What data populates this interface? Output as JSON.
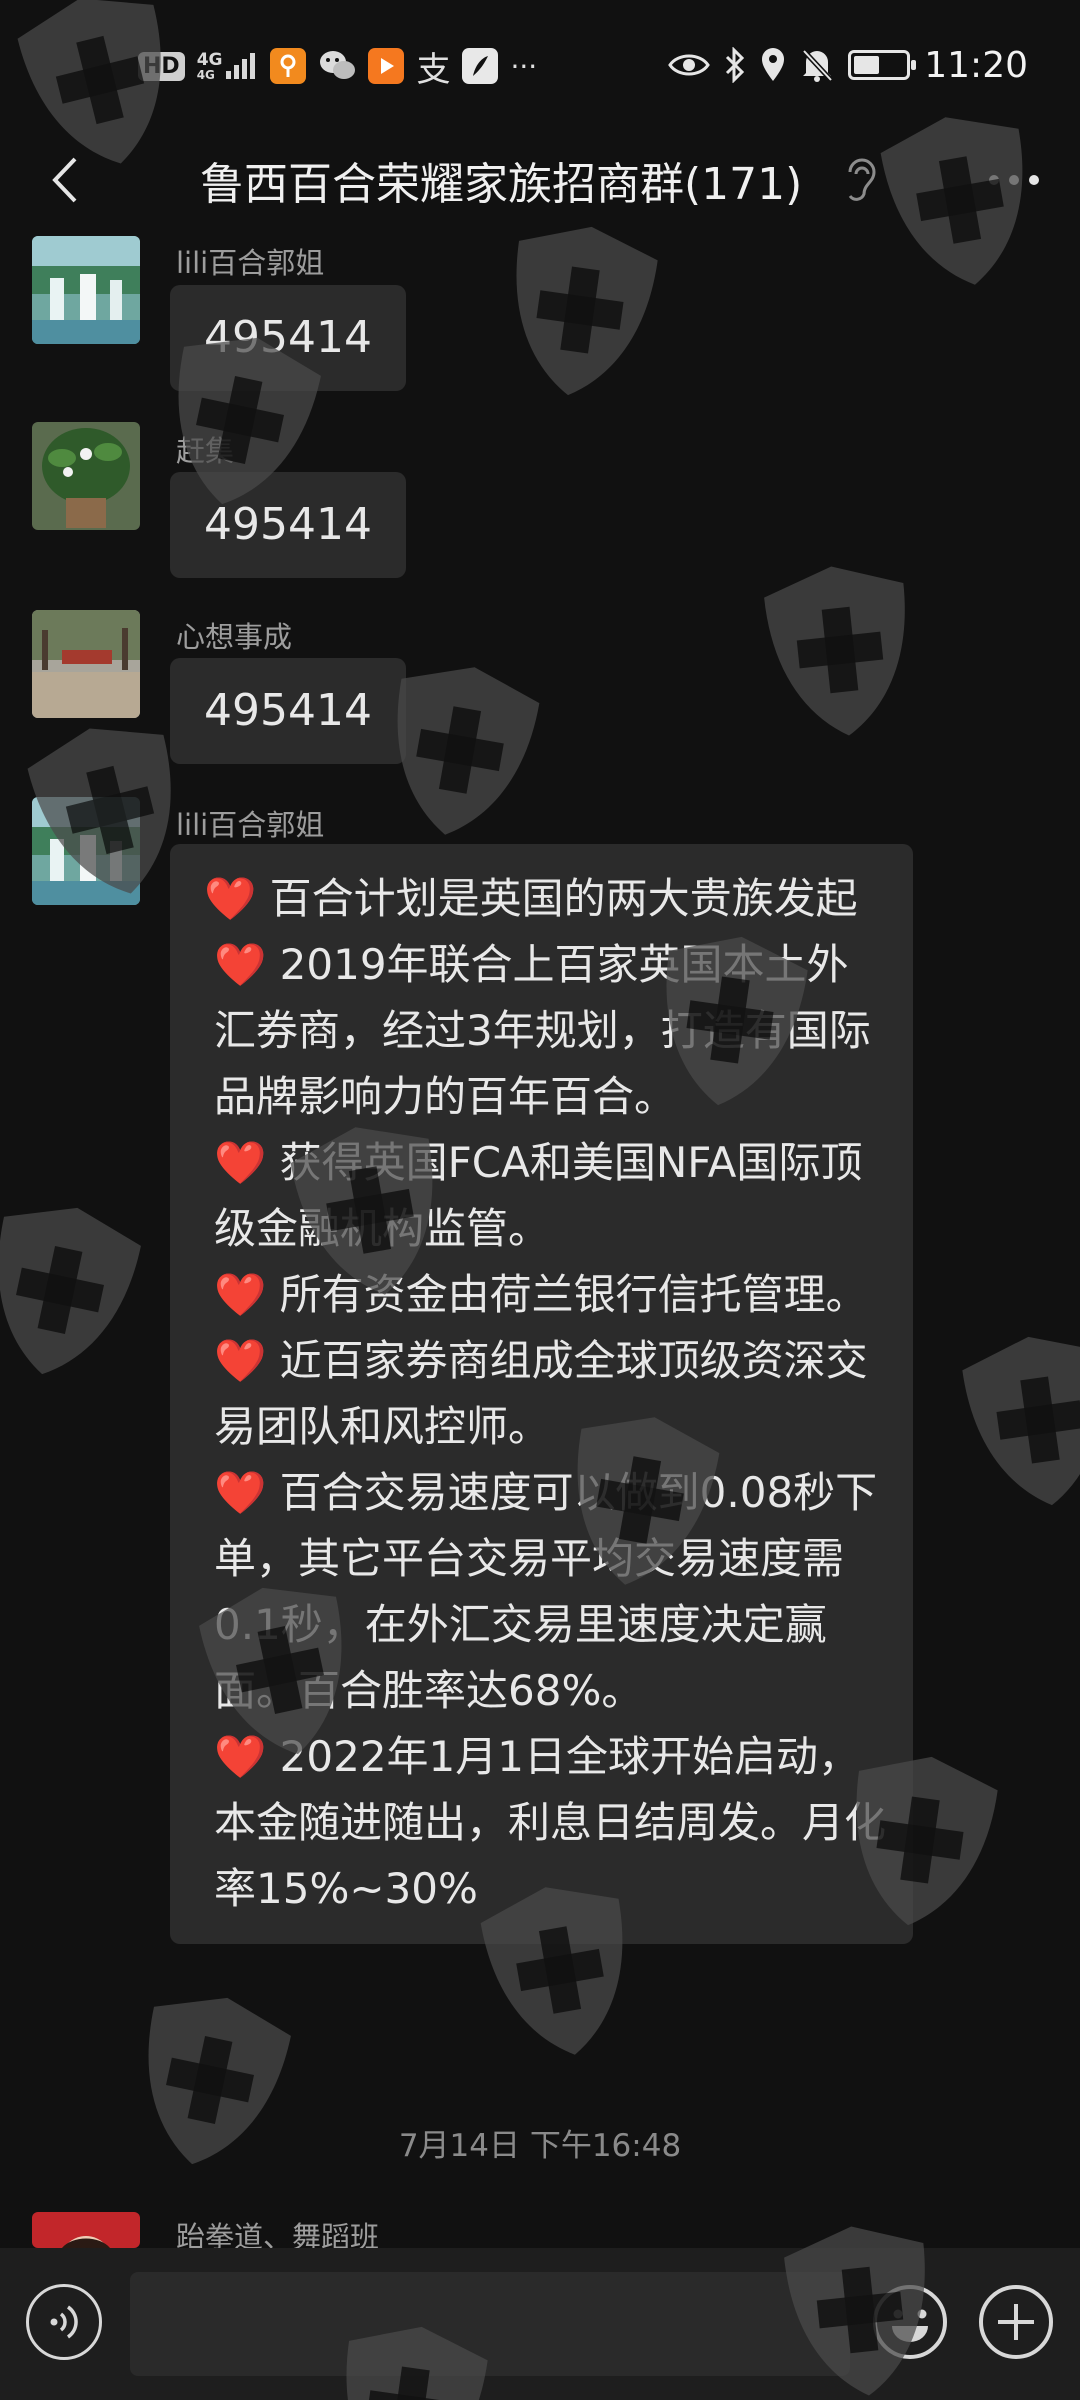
{
  "status_bar": {
    "hd": "HD",
    "network": "4G",
    "network_sub": "4G",
    "alipay_char": "支",
    "more": "···",
    "time": "11:20",
    "battery_level": 0.5
  },
  "chat": {
    "title": "鲁西百合荣耀家族招商群(171)"
  },
  "messages": [
    {
      "sender": "lili百合郭姐",
      "text": "495414"
    },
    {
      "sender": "赶集",
      "text": "495414"
    },
    {
      "sender": "心想事成",
      "text": "495414"
    },
    {
      "sender": "lili百合郭姐",
      "heart": "❤️",
      "paragraphs": [
        " 百合计划是英国的两大贵族发起",
        " 2019年联合上百家英国本土外汇券商，经过3年规划，打造有国际品牌影响力的百年百合。",
        " 获得英国FCA和美国NFA国际顶级金融机构监管。",
        " 所有资金由荷兰银行信托管理。",
        " 近百家券商组成全球顶级资深交易团队和风控师。",
        " 百合交易速度可以做到0.08秒下单，其它平台交易平均交易速度需0.1秒，在外汇交易里速度决定赢面。百合胜率达68%。",
        " 2022年1月1日全球开始启动，本金随进随出，利息日结周发。月化率15%~30%"
      ]
    },
    {
      "sender": "跆拳道、舞蹈班"
    }
  ],
  "timestamp": "7月14日 下午16:48",
  "input": {
    "value": ""
  },
  "colors": {
    "background": "#111111",
    "bubble": "#2b2b2b",
    "heart": "#e8332e",
    "watermark": "#4a4a4a"
  },
  "icons": [
    "back-arrow-icon",
    "ear-icon",
    "more-dots-icon",
    "voice-icon",
    "emoji-icon",
    "plus-icon",
    "eye-icon",
    "bluetooth-icon",
    "location-icon",
    "bell-off-icon",
    "shield-cross-watermark"
  ]
}
